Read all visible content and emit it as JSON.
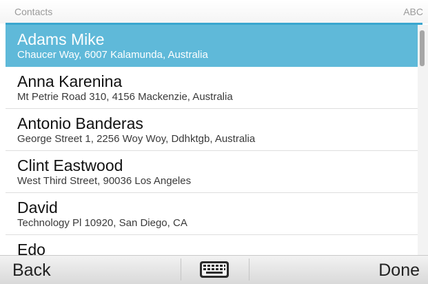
{
  "header": {
    "title": "Contacts",
    "input_mode": "ABC"
  },
  "contacts": [
    {
      "name": "Adams Mike",
      "address": "Chaucer Way, 6007 Kalamunda, Australia",
      "selected": true
    },
    {
      "name": "Anna Karenina",
      "address": "Mt Petrie Road  310, 4156 Mackenzie, Australia",
      "selected": false
    },
    {
      "name": "Antonio Banderas",
      "address": "George Street  1, 2256 Woy Woy, Ddhktgb, Australia",
      "selected": false
    },
    {
      "name": "Clint Eastwood",
      "address": "West Third Street, 90036 Los Angeles",
      "selected": false
    },
    {
      "name": "David",
      "address": "Technology Pl  10920, San Diego, CA",
      "selected": false
    },
    {
      "name": "Edo",
      "address": "",
      "selected": false
    }
  ],
  "toolbar": {
    "back_label": "Back",
    "done_label": "Done",
    "keyboard_icon": "keyboard-icon"
  },
  "colors": {
    "accent": "#3aa6cf",
    "selected_row": "#5fb9d9"
  }
}
